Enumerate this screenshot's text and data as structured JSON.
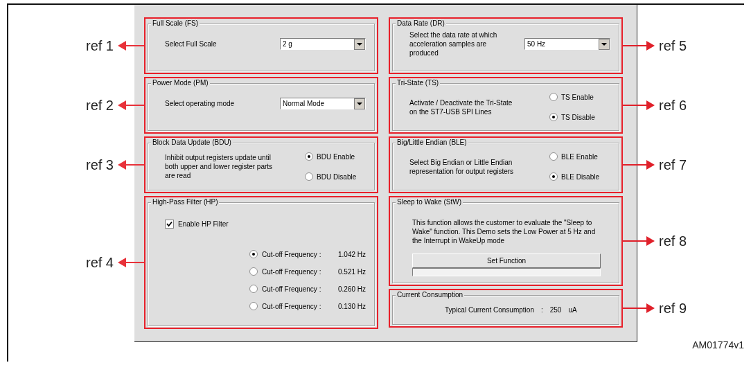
{
  "figure_id": "AM01774v1",
  "left_column": [
    {
      "ref": "ref 1",
      "title": "Full Scale (FS)",
      "kind": "dropdown",
      "label": "Select Full Scale",
      "value": "2 g"
    },
    {
      "ref": "ref 2",
      "title": "Power Mode (PM)",
      "kind": "dropdown",
      "label": "Select operating mode",
      "value": "Normal Mode"
    },
    {
      "ref": "ref 3",
      "title": "Block Data Update (BDU)",
      "kind": "radio",
      "description": "Inhibit output registers update until both upper and lower register parts are read",
      "options": [
        {
          "label": "BDU Enable",
          "selected": true
        },
        {
          "label": "BDU Disable",
          "selected": false
        }
      ]
    },
    {
      "ref": "ref 4",
      "title": "High-Pass Filter (HP)",
      "kind": "filter",
      "checkbox": {
        "label": "Enable HP Filter",
        "checked": true
      },
      "options": [
        {
          "label": "Cut-off Frequency :",
          "value": "1.042 Hz",
          "selected": true
        },
        {
          "label": "Cut-off Frequency :",
          "value": "0.521 Hz",
          "selected": false
        },
        {
          "label": "Cut-off Frequency :",
          "value": "0.260 Hz",
          "selected": false
        },
        {
          "label": "Cut-off Frequency :",
          "value": "0.130 Hz",
          "selected": false
        }
      ]
    }
  ],
  "right_column": [
    {
      "ref": "ref 5",
      "title": "Data Rate (DR)",
      "kind": "dropdown",
      "label": "Select the data rate at which acceleration samples are produced",
      "value": "50 Hz"
    },
    {
      "ref": "ref 6",
      "title": "Tri-State (TS)",
      "kind": "radio",
      "description": "Activate / Deactivate the Tri-State on the ST7-USB SPI Lines",
      "options": [
        {
          "label": "TS Enable",
          "selected": false
        },
        {
          "label": "TS Disable",
          "selected": true
        }
      ]
    },
    {
      "ref": "ref 7",
      "title": "Big/Little Endian (BLE)",
      "kind": "radio",
      "description": "Select Big Endian or Little Endian representation for output registers",
      "options": [
        {
          "label": "BLE Enable",
          "selected": false
        },
        {
          "label": "BLE Disable",
          "selected": true
        }
      ]
    },
    {
      "ref": "ref 8",
      "title": "Sleep to Wake (StW)",
      "kind": "action",
      "description": "This function allows the customer to evaluate the \"Sleep to Wake\" function. This Demo sets the Low Power at 5 Hz and the Interrupt in WakeUp mode",
      "button": "Set Function",
      "level": 0
    },
    {
      "ref": "ref 9",
      "title": "Current Consumption",
      "kind": "readout",
      "label": "Typical Current Consumption",
      "separator": ":",
      "value": "250",
      "unit": "uA"
    }
  ]
}
